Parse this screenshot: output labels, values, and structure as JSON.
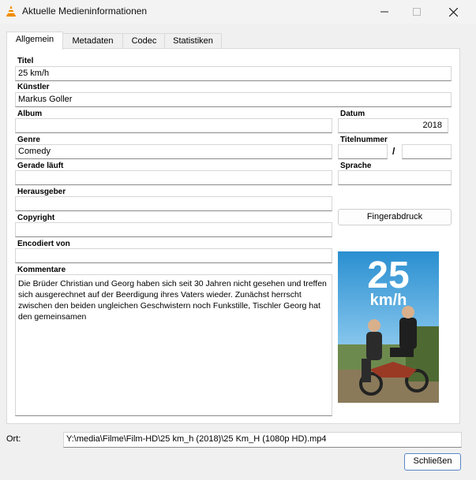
{
  "window": {
    "title": "Aktuelle Medieninformationen"
  },
  "tabs": [
    {
      "label": "Allgemein"
    },
    {
      "label": "Metadaten"
    },
    {
      "label": "Codec"
    },
    {
      "label": "Statistiken"
    }
  ],
  "fields": {
    "titel": {
      "label": "Titel",
      "value": "25 km/h"
    },
    "kuenstler": {
      "label": "Künstler",
      "value": "Markus Goller"
    },
    "album": {
      "label": "Album",
      "value": ""
    },
    "datum": {
      "label": "Datum",
      "value": "2018"
    },
    "genre": {
      "label": "Genre",
      "value": "Comedy"
    },
    "titelnummer": {
      "label": "Titelnummer",
      "value": "",
      "total": "",
      "separator": "/"
    },
    "gerade_laeuft": {
      "label": "Gerade läuft",
      "value": ""
    },
    "sprache": {
      "label": "Sprache",
      "value": ""
    },
    "herausgeber": {
      "label": "Herausgeber",
      "value": ""
    },
    "copyright": {
      "label": "Copyright",
      "value": ""
    },
    "encodiert_von": {
      "label": "Encodiert von",
      "value": ""
    },
    "kommentare": {
      "label": "Kommentare",
      "value": "Die Brüder Christian und Georg haben sich seit 30 Jahren nicht gesehen und treffen sich ausgerechnet auf der Beerdigung ihres Vaters wieder. Zunächst herrscht zwischen den beiden ungleichen Geschwistern noch Funkstille, Tischler Georg hat den gemeinsamen"
    }
  },
  "fingerprint_button": "Fingerabdruck",
  "poster": {
    "title_number": "25",
    "title_unit": "km/h"
  },
  "location": {
    "label": "Ort:",
    "value": "Y:\\media\\Filme\\Film-HD\\25 km_h (2018)\\25 Km_H (1080p HD).mp4"
  },
  "close_button": "Schließen",
  "icons": {
    "app": "vlc-cone-icon",
    "minimize": "minimize-icon",
    "maximize": "maximize-icon",
    "close": "close-icon"
  },
  "colors": {
    "accent_border": "#5a87c8",
    "vlc_orange": "#f08c00"
  }
}
